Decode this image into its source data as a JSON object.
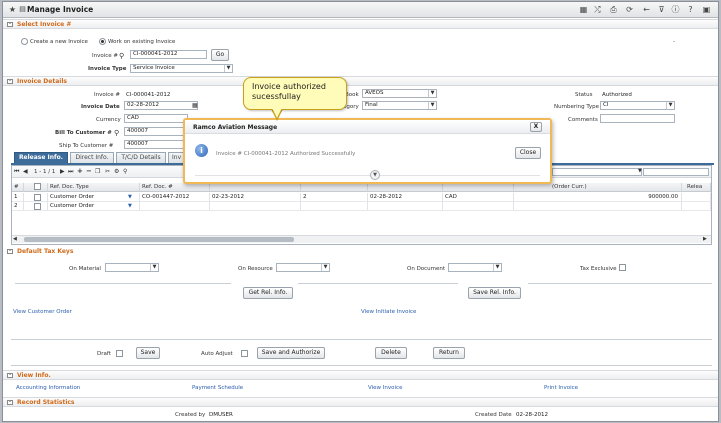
{
  "window": {
    "title": "Manage Invoice"
  },
  "sections": {
    "select_invoice": "Select Invoice #",
    "invoice_details": "Invoice Details",
    "default_tax_keys": "Default Tax Keys",
    "view_info": "View Info.",
    "record_statistics": "Record Statistics"
  },
  "select_invoice": {
    "radio_create": "Create a new Invoice",
    "radio_work": "Work on existing Invoice",
    "invoice_no_label": "Invoice #",
    "invoice_no_value": "CI-000041-2012",
    "go_label": "Go",
    "invoice_type_label": "Invoice Type",
    "invoice_type_value": "Service Invoice",
    "dash": "-"
  },
  "details": {
    "invoice_no_label": "Invoice #",
    "invoice_no_value": "CI-000041-2012",
    "invoice_date_label": "Invoice Date",
    "invoice_date_value": "02-28-2012",
    "currency_label": "Currency",
    "currency_value": "CAD",
    "bill_to_label": "Bill To Customer #",
    "bill_to_value": "400007",
    "ship_to_label": "Ship To Customer #",
    "ship_to_value": "400007",
    "book_label": "Book",
    "book_value": "AVEOS",
    "category_label": "egory",
    "category_value": "Final",
    "status_label": "Status",
    "status_value": "Authorized",
    "numbering_type_label": "Numbering Type",
    "numbering_type_value": "CI",
    "comments_label": "Comments"
  },
  "tabs": [
    {
      "label": "Release Info."
    },
    {
      "label": "Direct Info."
    },
    {
      "label": "T/C/D Details"
    },
    {
      "label": "Inv"
    }
  ],
  "grid": {
    "pager": "1 - 1 / 1",
    "headers": [
      "#",
      "Ref. Doc. Type",
      "Ref. Doc. #",
      "",
      "",
      "",
      "",
      "(Order Curr.)",
      "Relea"
    ],
    "rows": [
      {
        "num": "1",
        "type": "Customer Order",
        "doc": "CO-001447-2012",
        "date": "02-23-2012",
        "qty": "2",
        "date2": "02-28-2012",
        "curr": "CAD",
        "amount": "900000.00"
      },
      {
        "num": "2",
        "type": "Customer Order",
        "doc": "",
        "date": "",
        "qty": "",
        "date2": "",
        "curr": "",
        "amount": ""
      }
    ]
  },
  "tax": {
    "on_material": "On Material",
    "on_resource": "On Resource",
    "on_document": "On Document",
    "tax_exclusive": "Tax Exclusive",
    "get_rel_info": "Get Rel. Info.",
    "save_rel_info": "Save Rel. Info."
  },
  "links": {
    "view_customer_order": "View Customer Order",
    "view_initiate_invoice": "View Initiate Invoice"
  },
  "actions": {
    "draft_label": "Draft",
    "save": "Save",
    "auto_adjust_label": "Auto Adjust",
    "save_and_authorize": "Save and Authorize",
    "delete": "Delete",
    "return": "Return"
  },
  "view_info": {
    "accounting": "Accounting Information",
    "payment_schedule": "Payment Schedule",
    "view_invoice": "View Invoice",
    "print_invoice": "Print Invoice"
  },
  "stats": {
    "created_by_label": "Created by",
    "created_by_value": "DMUSER",
    "created_date_label": "Created Date",
    "created_date_value": "02-28-2012"
  },
  "tooltip": {
    "line1": "Invoice authorized",
    "line2": "sucessfullay"
  },
  "dialog": {
    "title": "Ramco Aviation Message",
    "close_x": "X",
    "message": "Invoice # CI-000041-2012 Authorized Successfully",
    "close_button": "Close"
  },
  "colors": {
    "accent_section": "#d06a1a",
    "tab_active": "#3d6c9a",
    "link": "#2a5db0",
    "dialog_border": "#f1b955",
    "tooltip_bg": "#fffbb8"
  }
}
